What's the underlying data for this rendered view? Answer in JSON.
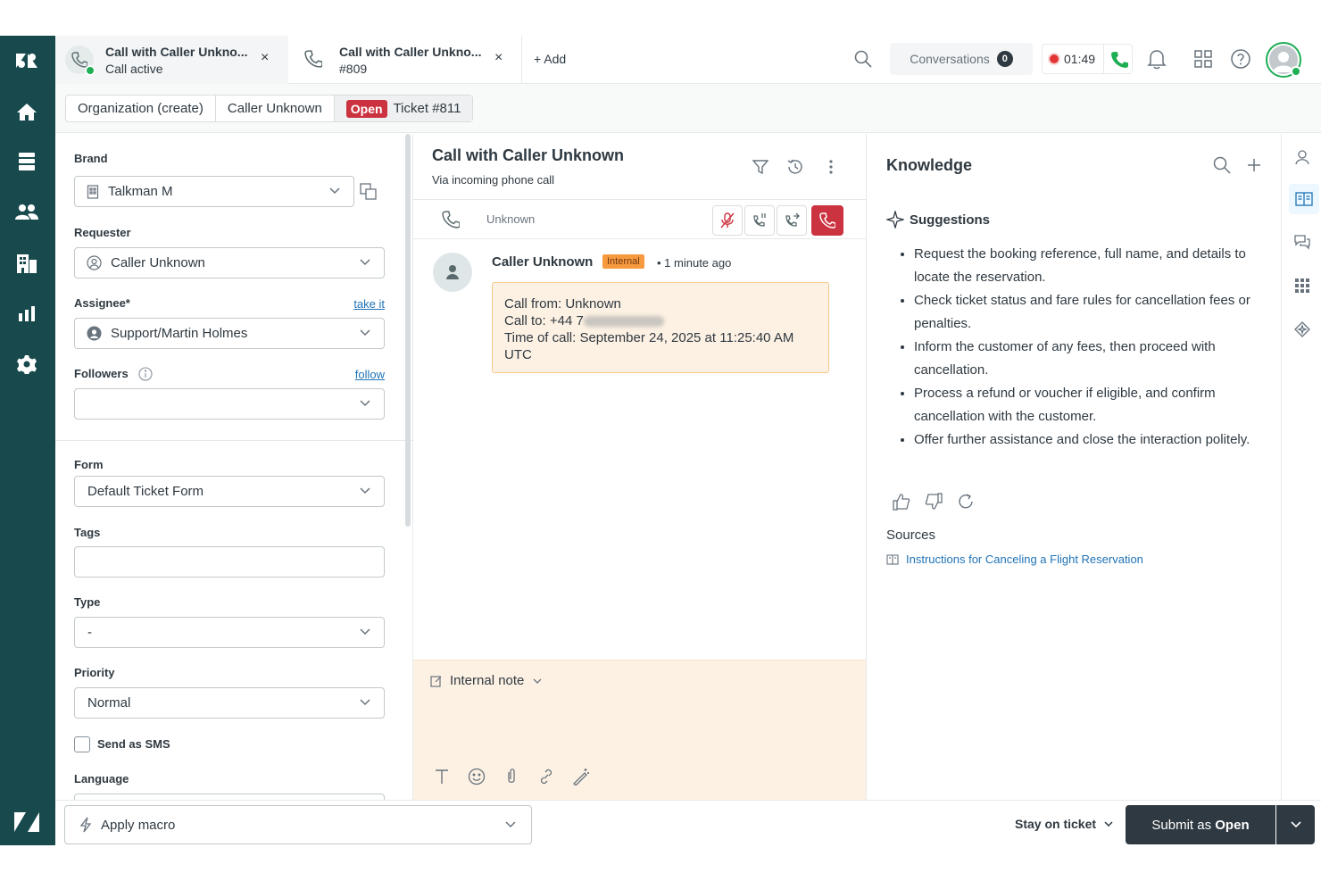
{
  "tabs": [
    {
      "title": "Call with Caller Unkno...",
      "subtitle": "Call active"
    },
    {
      "title": "Call with Caller Unkno...",
      "subtitle": "#809"
    }
  ],
  "add_tab_label": "+ Add",
  "conversations": {
    "label": "Conversations",
    "count": "0"
  },
  "call_timer": "01:49",
  "breadcrumb": {
    "org": "Organization (create)",
    "user": "Caller Unknown",
    "status": "Open",
    "ticket": "Ticket #811"
  },
  "fields": {
    "brand": {
      "label": "Brand",
      "value": "Talkman M"
    },
    "requester": {
      "label": "Requester",
      "value": "Caller Unknown"
    },
    "assignee": {
      "label": "Assignee*",
      "link": "take it",
      "value": "Support/Martin Holmes"
    },
    "followers": {
      "label": "Followers",
      "link": "follow",
      "value": ""
    },
    "form": {
      "label": "Form",
      "value": "Default Ticket Form"
    },
    "tags": {
      "label": "Tags",
      "value": ""
    },
    "type": {
      "label": "Type",
      "value": "-"
    },
    "priority": {
      "label": "Priority",
      "value": "Normal"
    },
    "send_sms": {
      "label": "Send as SMS"
    },
    "language": {
      "label": "Language"
    }
  },
  "conversation": {
    "title": "Call with Caller Unknown",
    "subtitle": "Via incoming phone call",
    "call_caller": "Unknown",
    "message": {
      "author": "Caller Unknown",
      "badge": "Internal",
      "time": "1 minute ago",
      "line1": "Call from: Unknown",
      "line2_prefix": "Call to: +44 7",
      "line3": "Time of call: September 24, 2025 at 11:25:40 AM",
      "line4": "UTC"
    },
    "composer_mode": "Internal note"
  },
  "knowledge": {
    "title": "Knowledge",
    "suggestions_title": "Suggestions",
    "suggestions": [
      "Request the booking reference, full name, and details to locate the reservation.",
      "Check ticket status and fare rules for cancellation fees or penalties.",
      "Inform the customer of any fees, then proceed with cancellation.",
      "Process a refund or voucher if eligible, and confirm cancellation with the customer.",
      "Offer further assistance and close the interaction politely."
    ],
    "sources_label": "Sources",
    "source": "Instructions for Canceling a Flight Reservation"
  },
  "footer": {
    "macro_label": "Apply macro",
    "stay_label": "Stay on ticket",
    "submit_prefix": "Submit as ",
    "submit_status": "Open"
  },
  "colors": {
    "nav_bg": "#17494d",
    "status_open": "#cc3340",
    "internal_badge": "#f79a3e",
    "note_bg": "#fdf1e3",
    "link": "#1f73b7",
    "online": "#1eae54"
  }
}
